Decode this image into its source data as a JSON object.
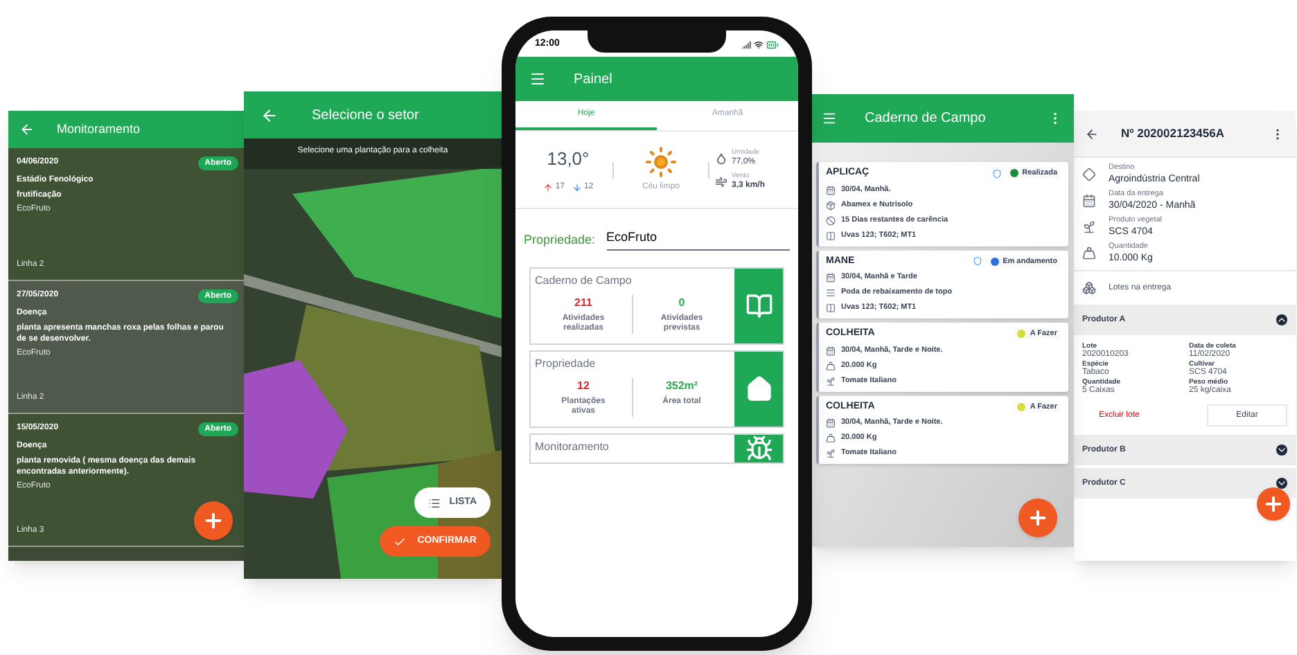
{
  "monitoring_screen": {
    "title": "Monitoramento",
    "entries": [
      {
        "date": "04/06/2020",
        "status": "Aberto",
        "category": "Estádio Fenológico",
        "description": "frutificação",
        "property": "EcoFruto",
        "location": "Linha 2"
      },
      {
        "date": "27/05/2020",
        "status": "Aberto",
        "category": "Doença",
        "description": "planta apresenta manchas roxa pelas folhas e parou de se desenvolver.",
        "property": "EcoFruto",
        "location": "Linha 2"
      },
      {
        "date": "15/05/2020",
        "status": "Aberto",
        "category": "Doença",
        "description": "planta removida ( mesma doença das demais encontradas anteriormente).",
        "property": "EcoFruto",
        "location": "Linha 3"
      }
    ]
  },
  "sector_screen": {
    "title": "Selecione o setor",
    "hint": "Selecione uma plantação para a colheita",
    "list_button": "LISTA",
    "confirm_button": "CONFIRMAR"
  },
  "dashboard_screen": {
    "time": "12:00",
    "title": "Painel",
    "tabs": [
      {
        "label": "Hoje",
        "selected": true
      },
      {
        "label": "Amanhã",
        "selected": false
      }
    ],
    "weather": {
      "temperature": "13,0°",
      "max": "17",
      "min": "12",
      "condition": "Céu limpo",
      "humidity_label": "Umidade",
      "humidity": "77,0%",
      "wind_label": "Vento",
      "wind": "3,3 km/h"
    },
    "property_label": "Propriedade:",
    "property_value": "EcoFruto",
    "cards": [
      {
        "kind": "book",
        "title": "Caderno de Campo",
        "stats": [
          {
            "value": "211",
            "label": "Atividades realizadas",
            "color": "#e0242f"
          },
          {
            "value": "0",
            "label": "Atividades previstas",
            "color": "#2fa84f"
          }
        ]
      },
      {
        "kind": "home",
        "title": "Propriedade",
        "stats": [
          {
            "value": "12",
            "label": "Plantações ativas",
            "color": "#e0242f"
          },
          {
            "value": "352m²",
            "label": "Área total",
            "color": "#2fa84f"
          }
        ]
      },
      {
        "kind": "bug",
        "title": "Monitoramento"
      }
    ]
  },
  "field_notebook_screen": {
    "title": "Caderno de Campo",
    "activities": [
      {
        "title": "APLICAÇ",
        "shield": true,
        "status": "Realizada",
        "color": "#1f8a3c",
        "details": [
          {
            "kind": "calendar",
            "text": "30/04, Manhã."
          },
          {
            "kind": "product",
            "text": "Abamex e Nutrisolo"
          },
          {
            "kind": "timer",
            "text": "15 Dias restantes de carência"
          },
          {
            "kind": "plot",
            "text": "Uvas 123; T602; MT1"
          }
        ]
      },
      {
        "title": "MANE",
        "shield": true,
        "status": "Em andamento",
        "color": "#2f6fe0",
        "details": [
          {
            "kind": "calendar",
            "text": "30/04, Manhã e Tarde"
          },
          {
            "kind": "task",
            "text": "Poda de rebaixamento de topo"
          },
          {
            "kind": "plot",
            "text": "Uvas 123; T602; MT1"
          }
        ]
      },
      {
        "title": "COLHEITA",
        "shield": false,
        "status": "A Fazer",
        "color": "#d4df3a",
        "details": [
          {
            "kind": "calendar",
            "text": "30/04, Manhã, Tarde e Noite."
          },
          {
            "kind": "scale",
            "text": "20.000 Kg"
          },
          {
            "kind": "plant",
            "text": "Tomate Italiano"
          }
        ]
      },
      {
        "title": "COLHEITA",
        "shield": false,
        "status": "A Fazer",
        "color": "#d4df3a",
        "details": [
          {
            "kind": "calendar",
            "text": "30/04, Manhã, Tarde e Noite."
          },
          {
            "kind": "scale",
            "text": "20.000 Kg"
          },
          {
            "kind": "plant",
            "text": "Tomate Italiano"
          }
        ]
      }
    ]
  },
  "delivery_screen": {
    "title": "Nº 202002123456A",
    "fields": [
      {
        "kind": "destination",
        "label": "Destino",
        "value": "Agroindústria Central"
      },
      {
        "kind": "calendar",
        "label": "Data da entrega",
        "value": "30/04/2020 - Manhã"
      },
      {
        "kind": "plant",
        "label": "Produto vegetal",
        "value": "SCS 4704"
      },
      {
        "kind": "scale",
        "label": "Quantidade",
        "value": "10.000 Kg"
      }
    ],
    "lots_label": "Lotes na entrega",
    "producers": [
      {
        "name": "Produtor A",
        "expanded": true,
        "details": [
          {
            "label": "Lote",
            "value": "2020010203"
          },
          {
            "label": "Data de coleta",
            "value": "11/02/2020"
          },
          {
            "label": "Espécie",
            "value": "Tabaco"
          },
          {
            "label": "Cultivar",
            "value": "SCS 4704"
          },
          {
            "label": "Quantidade",
            "value": "5 Caixas"
          },
          {
            "label": "Peso médio",
            "value": "25 kg/caixa"
          }
        ],
        "delete_link": "Excluir lote",
        "edit_button": "Editar"
      },
      {
        "name": "Produtor B",
        "expanded": false
      },
      {
        "name": "Produtor C",
        "expanded": false
      }
    ]
  }
}
